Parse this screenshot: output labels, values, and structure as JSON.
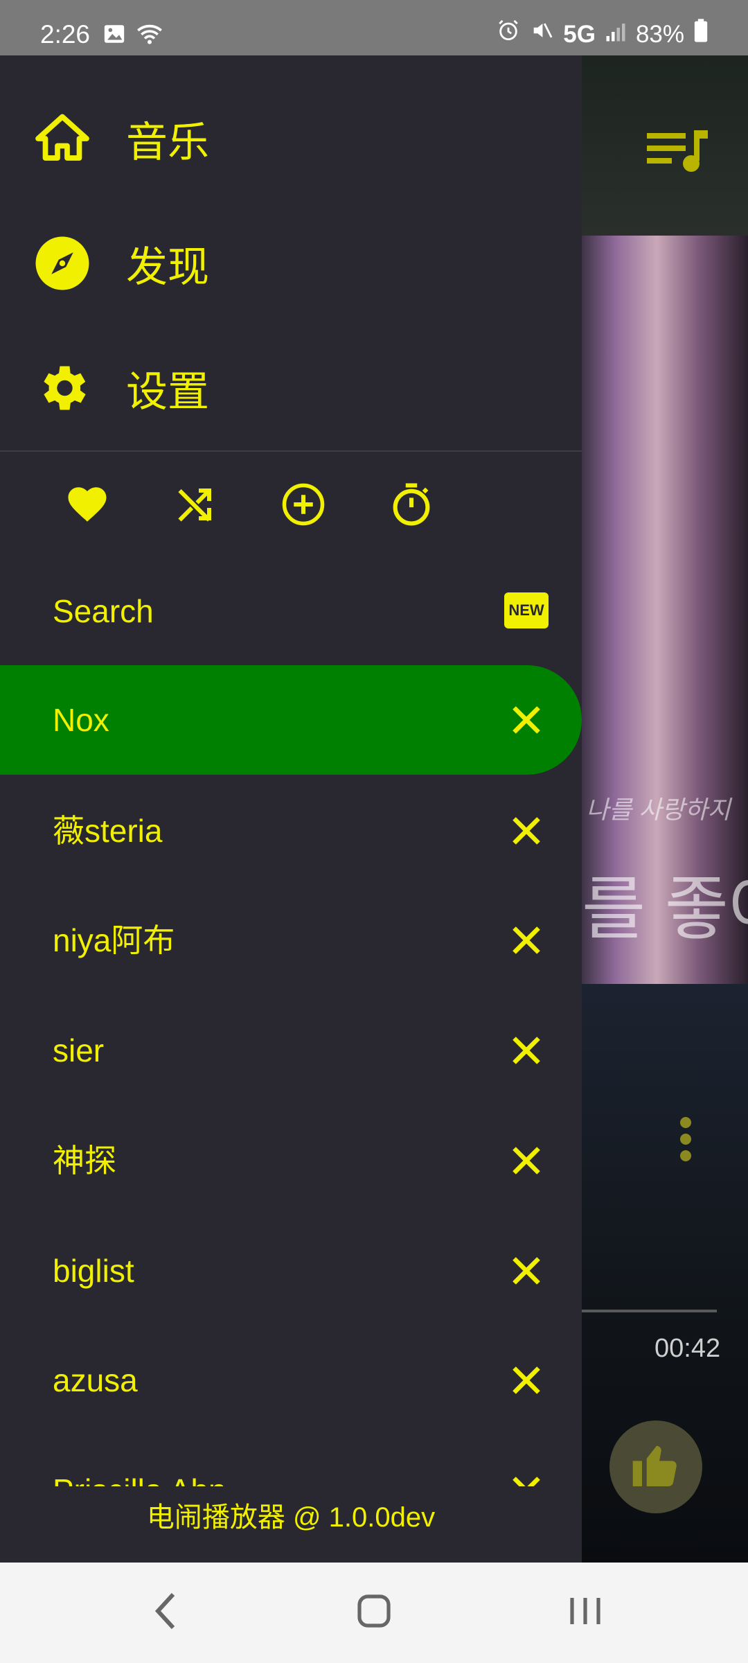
{
  "status_bar": {
    "time": "2:26",
    "network": "5G",
    "battery": "83%"
  },
  "drawer": {
    "nav": [
      {
        "label": "音乐",
        "icon": "home-icon"
      },
      {
        "label": "发现",
        "icon": "compass-icon"
      },
      {
        "label": "设置",
        "icon": "gear-icon"
      }
    ],
    "actions": [
      "heart-icon",
      "shuffle-icon",
      "add-circle-icon",
      "timer-icon"
    ],
    "search": {
      "label": "Search",
      "badge": "NEW"
    },
    "playlists": [
      {
        "label": "Nox",
        "active": true
      },
      {
        "label": "薇steria"
      },
      {
        "label": "niya阿布"
      },
      {
        "label": "sier"
      },
      {
        "label": "神探"
      },
      {
        "label": "biglist"
      },
      {
        "label": "azusa"
      },
      {
        "label": "Priscilla Ahn"
      }
    ],
    "footer": "电闹播放器 @ 1.0.0dev"
  },
  "background": {
    "art_text_1": "나를 사랑하지",
    "art_text_2": "를 좋아",
    "elapsed_time": "00:42"
  },
  "colors": {
    "accent": "#f0f000",
    "drawer_bg": "#292830",
    "active": "#008000"
  }
}
